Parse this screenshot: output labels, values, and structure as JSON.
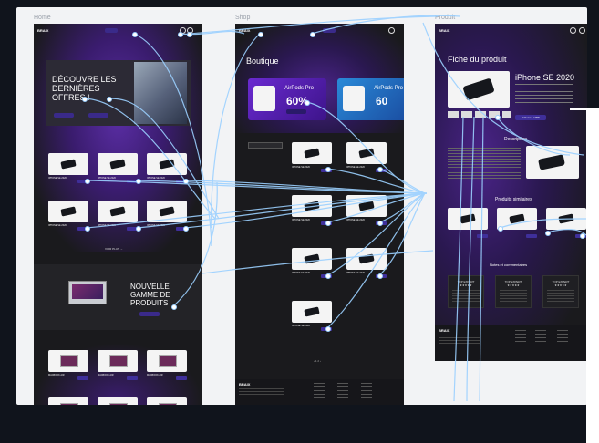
{
  "frames": {
    "home": "Home",
    "shop": "Shop",
    "product": "Produit"
  },
  "home": {
    "hero_title": "DÉCOUVRE LES DERNIÈRES OFFRES !",
    "products": [
      {
        "name": "IPHONE SE 2020"
      },
      {
        "name": "IPHONE SE 2020"
      },
      {
        "name": "IPHONE SE 2020"
      },
      {
        "name": "IPHONE SE 2020"
      },
      {
        "name": "IPHONE SE 2020"
      },
      {
        "name": "IPHONE SE 2020"
      }
    ],
    "see_all": "VOIR PLUS →",
    "new_range": "NOUVELLE GAMME DE PRODUITS",
    "macs": [
      {
        "name": "MACBOOK AIR"
      },
      {
        "name": "MACBOOK AIR"
      },
      {
        "name": "MACBOOK AIR"
      }
    ]
  },
  "shop": {
    "title": "Boutique",
    "promo_name": "AirPods Pro",
    "promo_discount": "60%",
    "promo_discount_2": "60",
    "products": [
      {
        "name": "IPHONE SE 2020"
      },
      {
        "name": "IPHONE SE 2020"
      },
      {
        "name": "IPHONE SE 2020"
      },
      {
        "name": "IPHONE SE 2020"
      },
      {
        "name": "IPHONE SE 2020"
      },
      {
        "name": "IPHONE SE 2020"
      },
      {
        "name": "IPHONE SE 2020"
      }
    ]
  },
  "product": {
    "title": "Fiche du produit",
    "name": "iPhone SE 2020",
    "buy": "Acheter - 109€",
    "description": "Description",
    "similar": "Produits similaires",
    "reviews_title": "Notes et commentaires",
    "reviews": [
      {
        "title": "TOP EXPERT",
        "stars": "★★★★★"
      },
      {
        "title": "TOP EXPERT",
        "stars": "★★★★★"
      },
      {
        "title": "TOP EXPERT",
        "stars": "★★★★★"
      }
    ]
  },
  "colors": {
    "accent": "#5b2ea6",
    "wire": "#9bd0ff",
    "card_bg": "#f4f4f4",
    "frame_bg": "#1a1a1d"
  }
}
